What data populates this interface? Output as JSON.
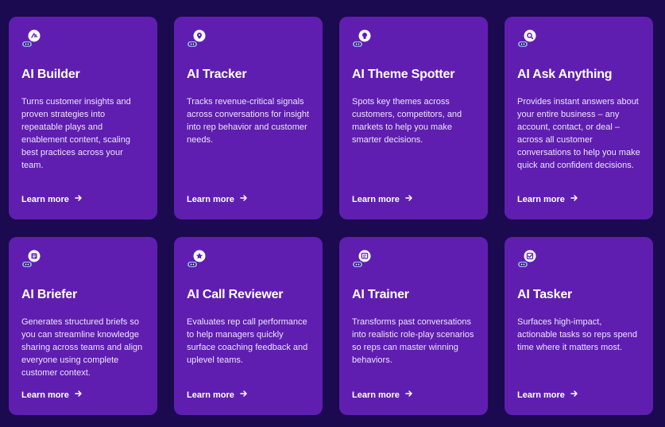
{
  "colors": {
    "page_background": "#1b0a4f",
    "card_background": "#5f1eb0",
    "text": "#ffffff"
  },
  "cards": [
    {
      "title": "AI Builder",
      "description": "Turns customer insights and proven strategies into repeatable plays and enablement content, scaling best practices across your team.",
      "link": "Learn more",
      "icon": "builder-icon"
    },
    {
      "title": "AI Tracker",
      "description": "Tracks revenue-critical signals across conversations for insight into rep behavior and customer needs.",
      "link": "Learn more",
      "icon": "tracker-icon"
    },
    {
      "title": "AI Theme Spotter",
      "description": "Spots key themes across customers, competitors, and markets to help you make smarter decisions.",
      "link": "Learn more",
      "icon": "lightbulb-icon"
    },
    {
      "title": "AI Ask Anything",
      "description": "Provides instant answers about your entire business – any account, contact, or deal – across all customer conversations to help you make quick and confident decisions.",
      "link": "Learn more",
      "icon": "search-icon"
    },
    {
      "title": "AI Briefer",
      "description": "Generates structured briefs so you can streamline knowledge sharing across teams and align everyone using complete customer context.",
      "link": "Learn more",
      "icon": "document-icon"
    },
    {
      "title": "AI Call Reviewer",
      "description": "Evaluates rep call performance to help managers quickly surface coaching feedback and uplevel teams.",
      "link": "Learn more",
      "icon": "star-icon"
    },
    {
      "title": "AI Trainer",
      "description": "Transforms past conversations into realistic role-play scenarios so reps can master winning behaviors.",
      "link": "Learn more",
      "icon": "chat-icon"
    },
    {
      "title": "AI Tasker",
      "description": "Surfaces high-impact, actionable tasks so reps spend time where it matters most.",
      "link": "Learn more",
      "icon": "task-check-icon"
    }
  ]
}
